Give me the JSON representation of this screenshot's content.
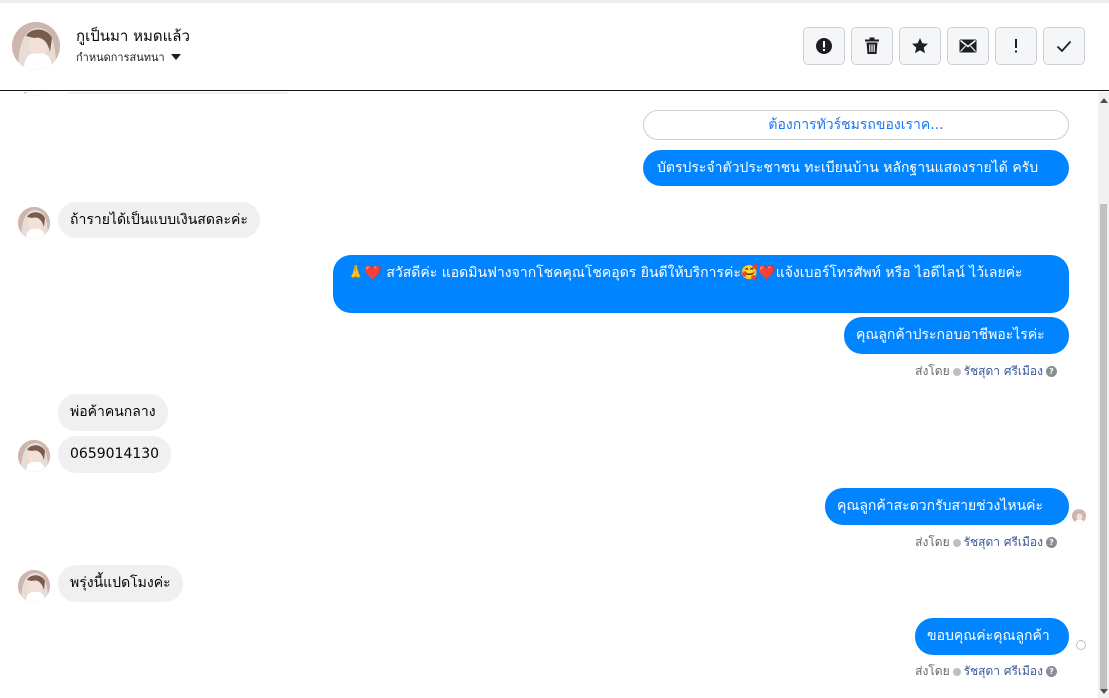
{
  "header": {
    "contact_name": "กูเป็นมา หมดแล้ว",
    "assign_label": "กำหนดการสนทนา"
  },
  "actions": [
    {
      "name": "spam-button",
      "icon": "alert-circle-icon"
    },
    {
      "name": "delete-button",
      "icon": "trash-icon"
    },
    {
      "name": "star-button",
      "icon": "star-icon"
    },
    {
      "name": "mark-unread-button",
      "icon": "envelope-icon"
    },
    {
      "name": "follow-up-button",
      "icon": "exclamation-icon"
    },
    {
      "name": "mark-done-button",
      "icon": "check-icon"
    }
  ],
  "colors": {
    "outgoing_bubble": "#0084ff",
    "incoming_bubble": "#f0f0f0",
    "link_blue": "#1877f2"
  },
  "thread": {
    "quick_reply": "ต้องการทัวร์ชมรถของเราค...",
    "messages": [
      {
        "id": "m1",
        "dir": "out",
        "text": "บัตรประจำตัวประชาชน ทะเบียนบ้าน หลักฐานแสดงรายได้ ครับ"
      },
      {
        "id": "m2",
        "dir": "in",
        "text": "ถ้ารายได้เป็นแบบเงินสดละค่ะ"
      },
      {
        "id": "m3",
        "dir": "out",
        "text": "🙏❤️ สวัสดีค่ะ แอดมินฟางจากโชคคุณโชคอุดร ยินดีให้บริการค่ะ🥰❤️แจ้งเบอร์โทรศัพท์ หรือ ไอดีไลน์  ไว้เลยค่ะ"
      },
      {
        "id": "m4",
        "dir": "out",
        "text": "คุณลูกค้าประกอบอาชีพอะไรค่ะ"
      },
      {
        "id": "m5",
        "dir": "in",
        "text": "พ่อค้าคนกลาง"
      },
      {
        "id": "m6",
        "dir": "in",
        "text": "0659014130"
      },
      {
        "id": "m7",
        "dir": "out",
        "text": "คุณลูกค้าสะดวกรับสายช่วงไหนค่ะ"
      },
      {
        "id": "m8",
        "dir": "in",
        "text": "พรุ่งนี้แปดโมงค่ะ"
      },
      {
        "id": "m9",
        "dir": "out",
        "text": "ขอบคุณค่ะคุณลูกค้า"
      }
    ],
    "sent_by_prefix": "ส่งโดย",
    "sent_by_name": "รัชสุดา ศรีเมือง",
    "help_glyph": "?"
  }
}
